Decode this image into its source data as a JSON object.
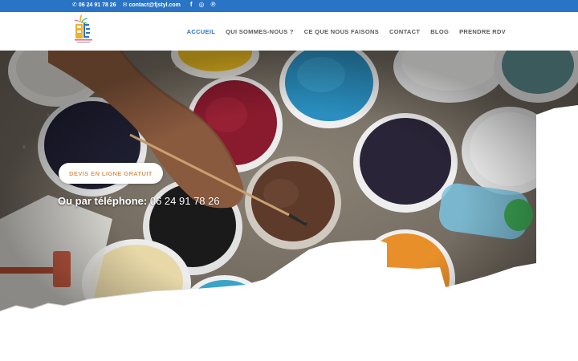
{
  "topbar": {
    "phone": "06 24 91 78 26",
    "email": "contact@fjstyl.com",
    "social": [
      {
        "name": "facebook-icon",
        "glyph": "f"
      },
      {
        "name": "instagram-icon",
        "glyph": "◎"
      },
      {
        "name": "pinterest-icon",
        "glyph": "℗"
      }
    ]
  },
  "nav": {
    "items": [
      {
        "id": "accueil",
        "label": "ACCUEIL",
        "active": true
      },
      {
        "id": "qui-sommes-nous",
        "label": "QUI SOMMES-NOUS ?"
      },
      {
        "id": "ce-que-nous-faisons",
        "label": "CE QUE NOUS FAISONS"
      },
      {
        "id": "contact",
        "label": "CONTACT"
      },
      {
        "id": "blog",
        "label": "BLOG"
      },
      {
        "id": "prendre-rdv",
        "label": "PRENDRE RDV"
      }
    ]
  },
  "hero": {
    "cta_label": "DEVIS EN LIGNE GRATUIT",
    "phone_prefix": "Ou par téléphone:",
    "phone_number": "06 24 91 78 26"
  },
  "colors": {
    "accent": "#2a74c5",
    "cta_text": "#e09a5a",
    "nav_text": "#5a5a5a"
  }
}
